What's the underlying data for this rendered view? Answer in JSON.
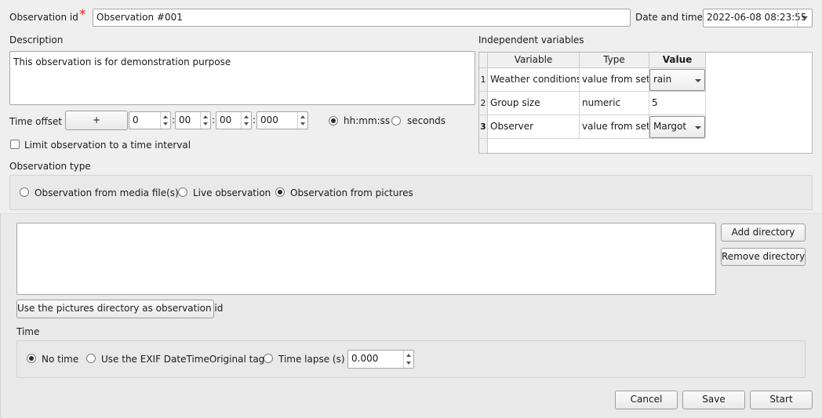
{
  "observation_id": {
    "label": "Observation id",
    "required_mark": "*",
    "value": "Observation #001"
  },
  "date_time": {
    "label": "Date and time",
    "value": "2022-06-08 08:23:55"
  },
  "description": {
    "label": "Description",
    "value": "This observation is for demonstration purpose"
  },
  "time_offset": {
    "label": "Time offset",
    "sign_button": "+",
    "days": "0",
    "hours": "00",
    "minutes": "00",
    "ms": "000",
    "format_hhmmss": "hh:mm:ss",
    "format_seconds": "seconds",
    "selected_format": "hh:mm:ss"
  },
  "limit_interval": {
    "label": "Limit observation to a time interval",
    "checked": false
  },
  "independent_variables": {
    "label": "Independent variables",
    "columns": [
      "Variable",
      "Type",
      "Value"
    ],
    "rows": [
      {
        "num": "1",
        "variable": "Weather conditions",
        "type": "value from set",
        "value": "rain",
        "combo": true
      },
      {
        "num": "2",
        "variable": "Group size",
        "type": "numeric",
        "value": "5",
        "combo": false
      },
      {
        "num": "3",
        "variable": "Observer",
        "type": "value from set",
        "value": "Margot",
        "combo": true
      }
    ]
  },
  "observation_type": {
    "label": "Observation type",
    "options": [
      "Observation from media file(s)",
      "Live observation",
      "Observation from pictures"
    ],
    "selected": "Observation from pictures"
  },
  "directories": {
    "add_button": "Add directory",
    "remove_button": "Remove directory",
    "use_dir_button": "Use the pictures directory as observation id"
  },
  "time": {
    "label": "Time",
    "options": [
      "No time",
      "Use the EXIF DateTimeOriginal tag",
      "Time lapse (s)"
    ],
    "selected": "No time",
    "time_lapse_value": "0.000"
  },
  "footer": {
    "cancel": "Cancel",
    "save": "Save",
    "start": "Start"
  }
}
